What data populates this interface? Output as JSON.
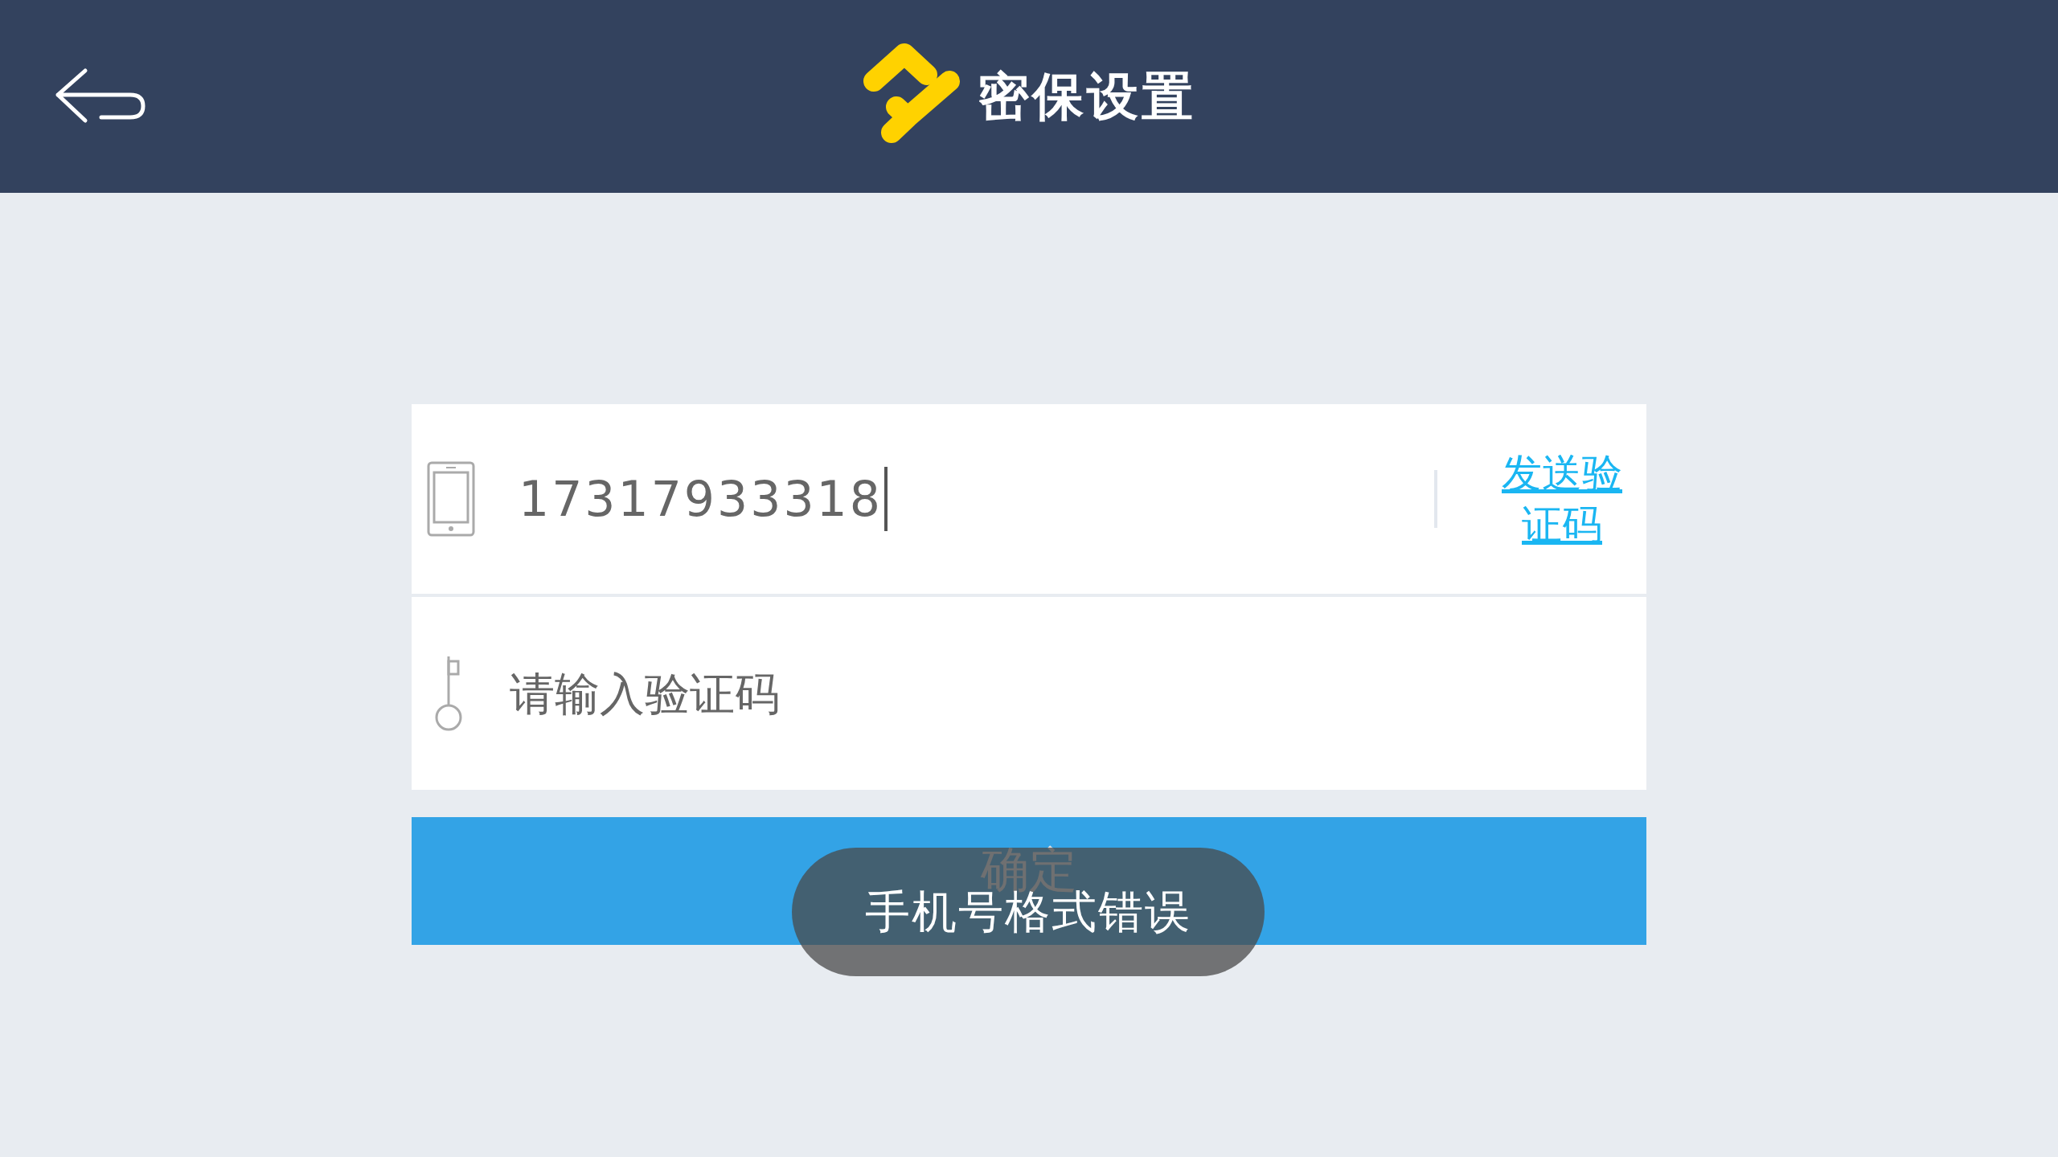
{
  "header": {
    "title": "密保设置"
  },
  "phone_field": {
    "value": "17317933318",
    "focused": true
  },
  "send_code_link": {
    "label": "发送验证码"
  },
  "code_field": {
    "placeholder": "请输入验证码"
  },
  "confirm_button": {
    "label": "确定"
  },
  "toast": {
    "message": "手机号格式错误"
  }
}
